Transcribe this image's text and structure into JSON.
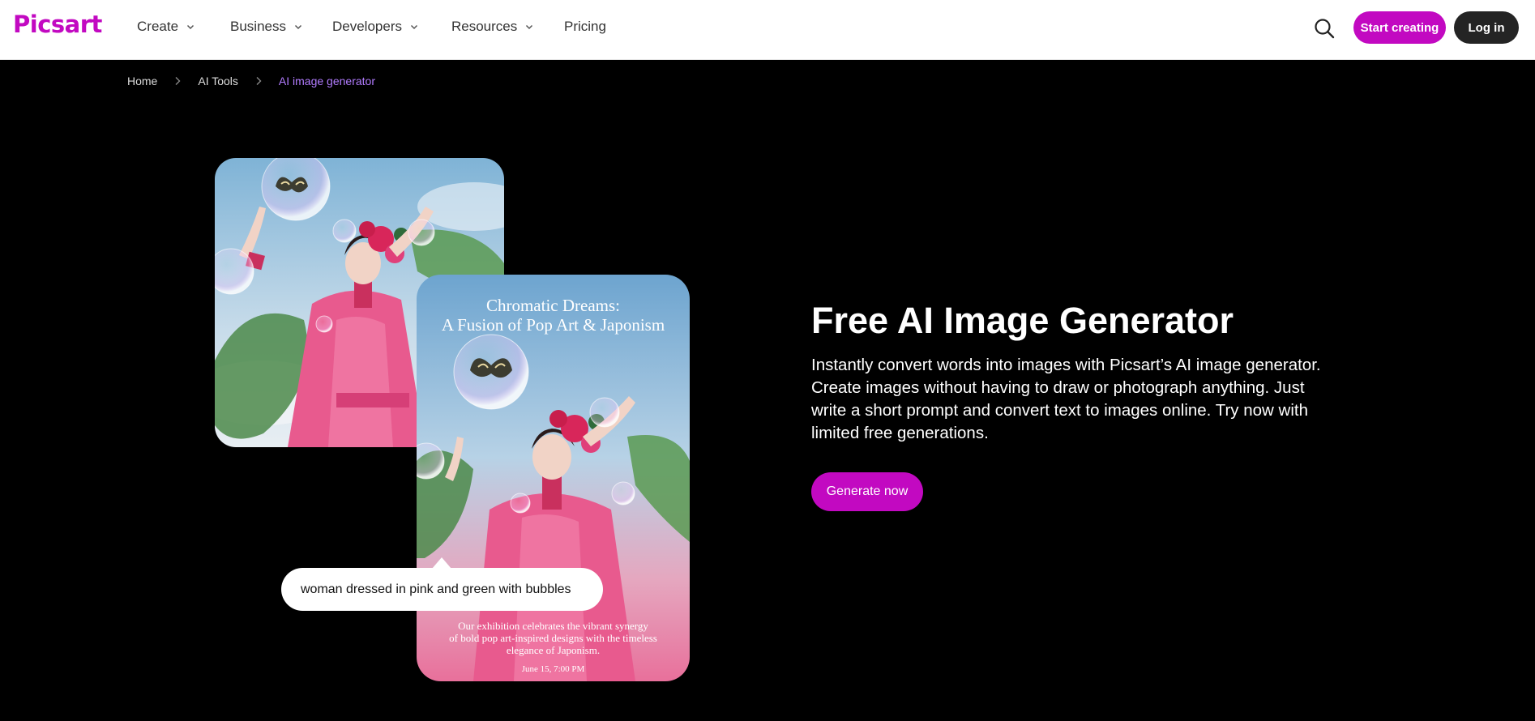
{
  "brand": {
    "logo_text": "Picsart",
    "accent_color": "#c209c1"
  },
  "nav": {
    "items": [
      {
        "label": "Create",
        "has_dropdown": true
      },
      {
        "label": "Business",
        "has_dropdown": true
      },
      {
        "label": "Developers",
        "has_dropdown": true
      },
      {
        "label": "Resources",
        "has_dropdown": true
      },
      {
        "label": "Pricing",
        "has_dropdown": false
      }
    ],
    "search_icon": "search-icon",
    "start_label": "Start creating",
    "login_label": "Log in"
  },
  "breadcrumb": {
    "items": [
      {
        "label": "Home"
      },
      {
        "label": "AI Tools"
      },
      {
        "label": "AI image generator"
      }
    ]
  },
  "poster": {
    "title_line1": "Chromatic Dreams:",
    "title_line2": "A Fusion of Pop Art & Japonism",
    "body_line1": "Our exhibition celebrates the vibrant synergy",
    "body_line2": "of bold pop art-inspired designs with the timeless",
    "body_line3": "elegance of Japonism.",
    "date": "June 15, 7:00 PM"
  },
  "prompt": {
    "text": "woman dressed in pink and green with bubbles"
  },
  "hero": {
    "title": "Free AI Image Generator",
    "description": "Instantly convert words into images with Picsart’s AI image generator. Create images without having to draw or photograph anything. Just write a short prompt and convert text to images online. Try now with limited free generations.",
    "cta_label": "Generate now"
  }
}
